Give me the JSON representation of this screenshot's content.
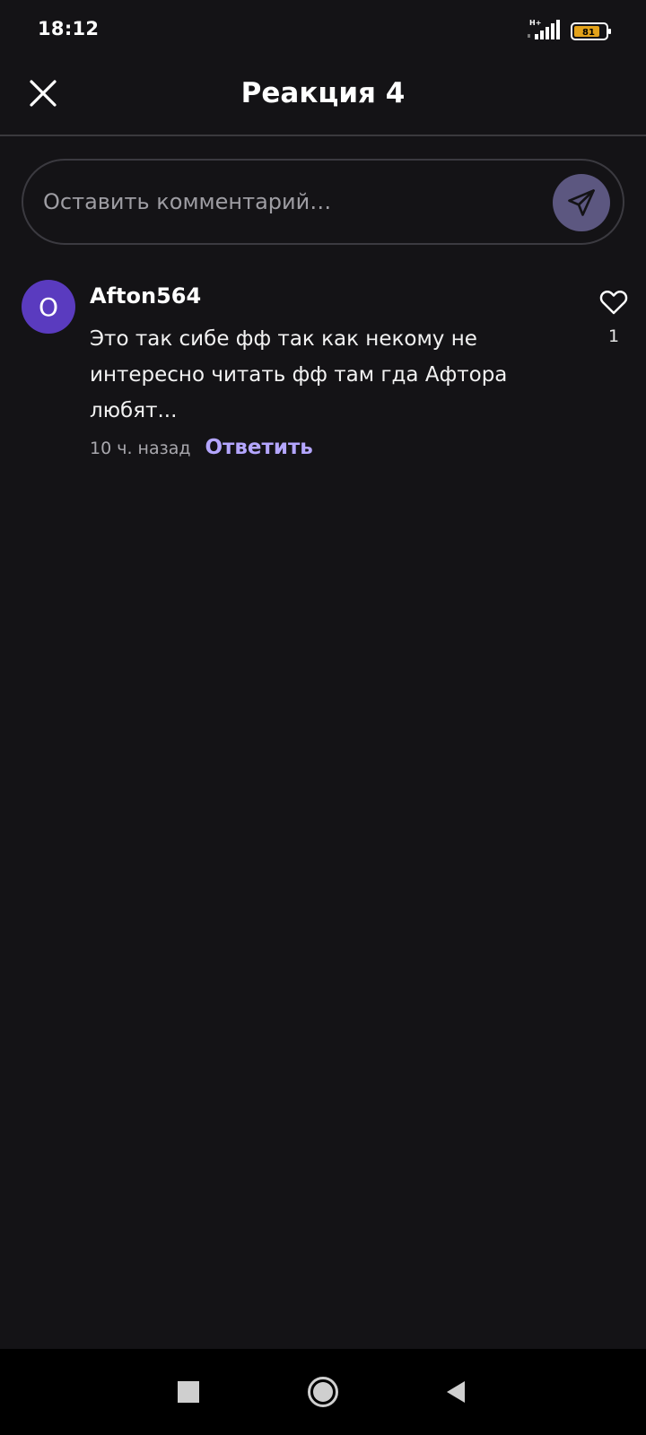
{
  "status_bar": {
    "time": "18:12",
    "network": "H+",
    "battery": "81"
  },
  "header": {
    "title": "Реакция 4",
    "close_icon": "close-icon"
  },
  "comment_input": {
    "placeholder": "Оставить комментарий…",
    "send_icon": "send-icon"
  },
  "comments": [
    {
      "avatar_letter": "O",
      "author": "Afton564",
      "text": "Это так сибе фф так как некому не интересно читать фф там гда Афтора любят...",
      "time_ago": "10 ч. назад",
      "reply_label": "Ответить",
      "likes": "1"
    }
  ],
  "colors": {
    "background": "#141316",
    "accent": "#b4a6ff",
    "avatar": "#5a3bbf",
    "send_button": "#5c5780"
  },
  "nav": {
    "recents_icon": "square-icon",
    "home_icon": "circle-icon",
    "back_icon": "triangle-back-icon"
  }
}
